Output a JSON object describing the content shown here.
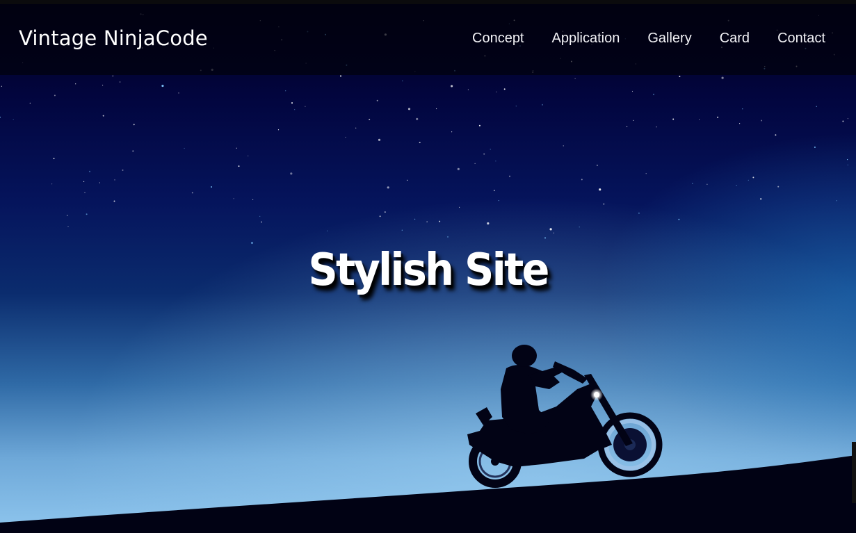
{
  "header": {
    "logo": "Vintage NinjaCode",
    "nav": [
      {
        "label": "Concept"
      },
      {
        "label": "Application"
      },
      {
        "label": "Gallery"
      },
      {
        "label": "Card"
      },
      {
        "label": "Contact"
      }
    ]
  },
  "hero": {
    "title": "Stylish Site",
    "image": "night-sky-motorcycle-rider-silhouette"
  },
  "colors": {
    "sky_top": "#02021f",
    "sky_mid": "#0a1e5c",
    "sky_horizon": "#8cc4ea",
    "ground": "#010214",
    "text": "#ffffff"
  }
}
